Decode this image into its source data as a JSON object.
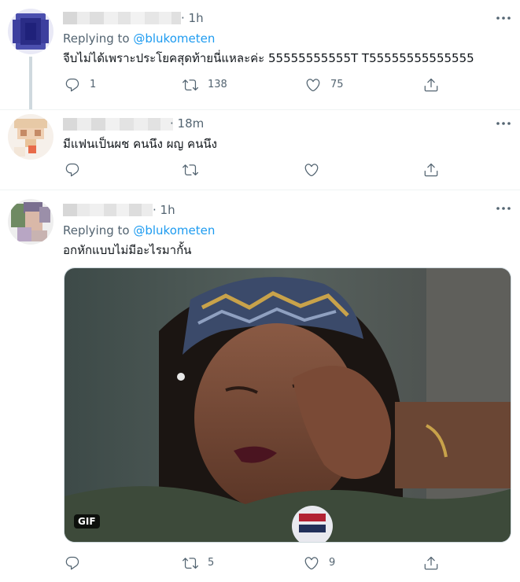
{
  "tweets": [
    {
      "time": "· 1h",
      "reply_prefix": "Replying to",
      "reply_handle": "@blukometen",
      "text": "จีบไม่ได้เพราะประโยคสุดท้ายนี่แหละค่ะ 55555555555T T55555555555555",
      "actions": {
        "reply": "1",
        "retweet": "138",
        "like": "75"
      }
    },
    {
      "time": "· 18m",
      "text": "มีแฟนเป็นผช คนนึง ผญ คนนึง",
      "actions": {
        "reply": "",
        "retweet": "",
        "like": ""
      }
    },
    {
      "time": "· 1h",
      "reply_prefix": "Replying to",
      "reply_handle": "@blukometen",
      "text": "อกหักแบบไม่มีอะไรมากั้น",
      "media_badge": "GIF",
      "actions": {
        "reply": "",
        "retweet": "5",
        "like": "9"
      }
    }
  ],
  "icons": {
    "reply": "reply-bubble-icon",
    "retweet": "retweet-arrows-icon",
    "like": "heart-icon",
    "share": "share-upload-icon",
    "more": "more-dots-icon"
  },
  "colors": {
    "link": "#1d9bf0",
    "muted": "#536471",
    "text": "#0f1419",
    "thread_line": "#cfd9de"
  }
}
